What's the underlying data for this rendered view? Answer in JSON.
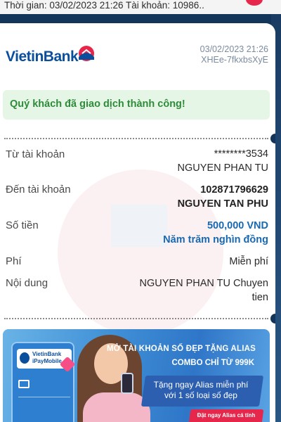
{
  "status_bar": {
    "text": "Thời gian: 03/02/2023 21:26 Tài khoản: 10986.."
  },
  "receipt": {
    "logo_text": "VietinBank",
    "datetime": "03/02/2023 21:26",
    "transaction_code": "XHEe-7fkxbsXyE",
    "success_message": "Quý khách đã giao dịch thành công!",
    "rows": [
      {
        "label": "Từ tài khoản",
        "value_line1": "********3534",
        "value_line2": "NGUYEN PHAN TU"
      },
      {
        "label": "Đến tài khoản",
        "value_line1": "102871796629",
        "value_line2": "NGUYEN TAN PHU"
      },
      {
        "label": "Số tiền",
        "value_line1": "500,000 VND",
        "value_line2": "Năm trăm nghìn đồng"
      },
      {
        "label": "Phí",
        "value_line1": "Miễn phí"
      },
      {
        "label": "Nội dung",
        "value_line1": "NGUYEN PHAN TU Chuyen",
        "value_line2": "tien"
      }
    ]
  },
  "banner": {
    "app_name_line1": "VietinBank",
    "app_name_line2": "iPayMobile",
    "headline1": "MỞ TÀI KHOẢN SỐ ĐẸP TẶNG ALIAS",
    "headline2": "COMBO CHỈ TỪ 999K",
    "offer_line1": "Tặng ngay Alias miễn phí",
    "offer_line2": "với 1 số loại số đẹp",
    "cta": "Đặt ngay Alias cá tính"
  },
  "colors": {
    "brand_blue": "#0b4f9c",
    "brand_red": "#e7264b",
    "success_green": "#2e8b3a",
    "amount_blue": "#1769b4"
  }
}
